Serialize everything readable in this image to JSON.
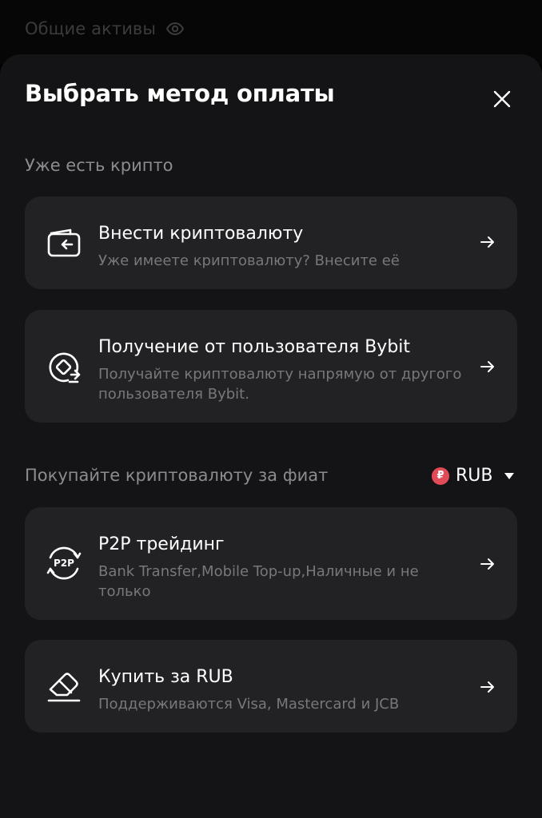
{
  "backdrop": {
    "title": "Общие активы",
    "visibility_icon": "eye-icon"
  },
  "sheet": {
    "title": "Выбрать метод оплаты",
    "close_icon": "close-icon"
  },
  "sections": {
    "crypto_label": "Уже есть крипто",
    "fiat_label": "Покупайте криптовалюту за фиат"
  },
  "currency": {
    "symbol": "₽",
    "code": "RUB",
    "badge_color": "#e04b57"
  },
  "options": [
    {
      "title": "Внести криптовалюту",
      "subtitle": "Уже имеете криптовалюту? Внесите её",
      "icon": "wallet-deposit-icon"
    },
    {
      "title": "Получение от пользователя Bybit",
      "subtitle": "Получайте криптовалюту напрямую от другого пользователя Bybit.",
      "icon": "user-transfer-icon"
    },
    {
      "title": "P2P трейдинг",
      "subtitle": "Bank Transfer,Mobile Top-up,Наличные и не только",
      "icon": "p2p-icon",
      "icon_text": "P2P"
    },
    {
      "title": "Купить за RUB",
      "subtitle": "Поддерживаются Visa, Mastercard и JCB",
      "icon": "card-buy-icon"
    }
  ],
  "colors": {
    "sheet_bg": "#141416",
    "card_bg": "#222225",
    "muted_text": "#77777c",
    "section_text": "#8b8b90"
  }
}
